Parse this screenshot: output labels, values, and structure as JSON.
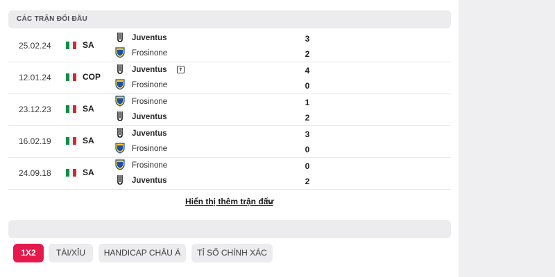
{
  "section_title": "CÁC TRẬN ĐỐI ĐẦU",
  "matches": [
    {
      "date": "25.02.24",
      "competition": "SA",
      "home": "Juventus",
      "away": "Frosinone",
      "home_score": "3",
      "away_score": "2"
    },
    {
      "date": "12.01.24",
      "competition": "COP",
      "home": "Juventus",
      "away": "Frosinone",
      "home_score": "4",
      "away_score": "0"
    },
    {
      "date": "23.12.23",
      "competition": "SA",
      "home": "Frosinone",
      "away": "Juventus",
      "home_score": "1",
      "away_score": "2"
    },
    {
      "date": "16.02.19",
      "competition": "SA",
      "home": "Juventus",
      "away": "Frosinone",
      "home_score": "3",
      "away_score": "0"
    },
    {
      "date": "24.09.18",
      "competition": "SA",
      "home": "Frosinone",
      "away": "Juventus",
      "home_score": "0",
      "away_score": "2"
    }
  ],
  "show_more_label": "Hiển thị thêm trận đấu",
  "tabs": [
    "1X2",
    "TÀI/XỈU",
    "HANDICAP CHÂU Á",
    "TỈ SỐ CHÍNH XÁC"
  ],
  "colors": {
    "accent": "#e5194b",
    "flag_green": "#009246",
    "flag_red": "#ce2b37"
  }
}
